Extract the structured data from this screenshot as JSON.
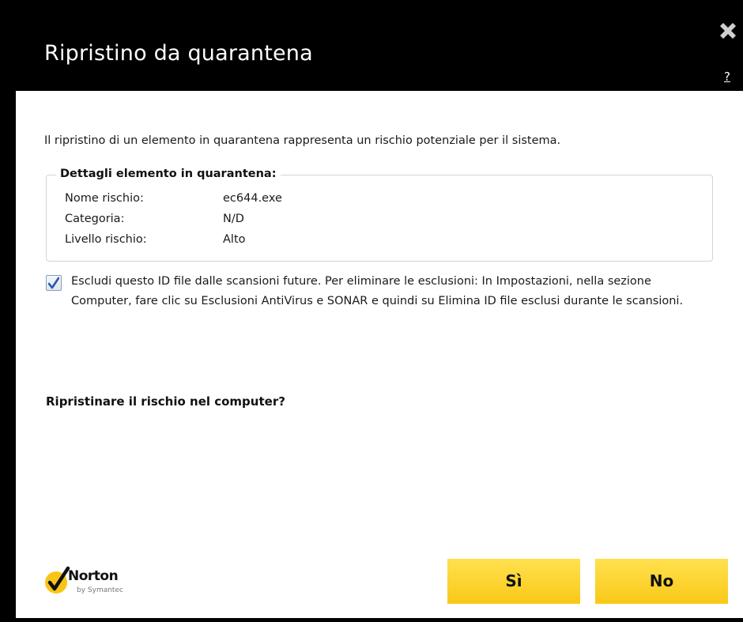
{
  "dialog": {
    "title": "Ripristino da quarantena",
    "help_label": "?",
    "close_icon": "close-x-icon"
  },
  "intro_text": "Il ripristino di un elemento in quarantena rappresenta un rischio potenziale per il sistema.",
  "details": {
    "legend": "Dettagli elemento in quarantena:",
    "rows": [
      {
        "label": "Nome rischio:",
        "value": "ec644.exe"
      },
      {
        "label": "Categoria:",
        "value": "N/D"
      },
      {
        "label": "Livello rischio:",
        "value": "Alto"
      }
    ]
  },
  "exclude_checkbox": {
    "checked": true,
    "label": "Escludi questo ID file dalle scansioni future. Per eliminare le esclusioni: In Impostazioni, nella sezione Computer, fare clic su Esclusioni AntiVirus e SONAR e quindi su Elimina ID file esclusi durante le scansioni."
  },
  "question": "Ripristinare il rischio nel computer?",
  "logo": {
    "name": "Norton",
    "subtitle": "by Symantec",
    "icon": "norton-check-icon"
  },
  "buttons": {
    "yes_label": "Sì",
    "no_label": "No"
  },
  "colors": {
    "title_bar": "#000000",
    "button_yellow": "#fad12c",
    "logo_yellow": "#f9c515"
  }
}
